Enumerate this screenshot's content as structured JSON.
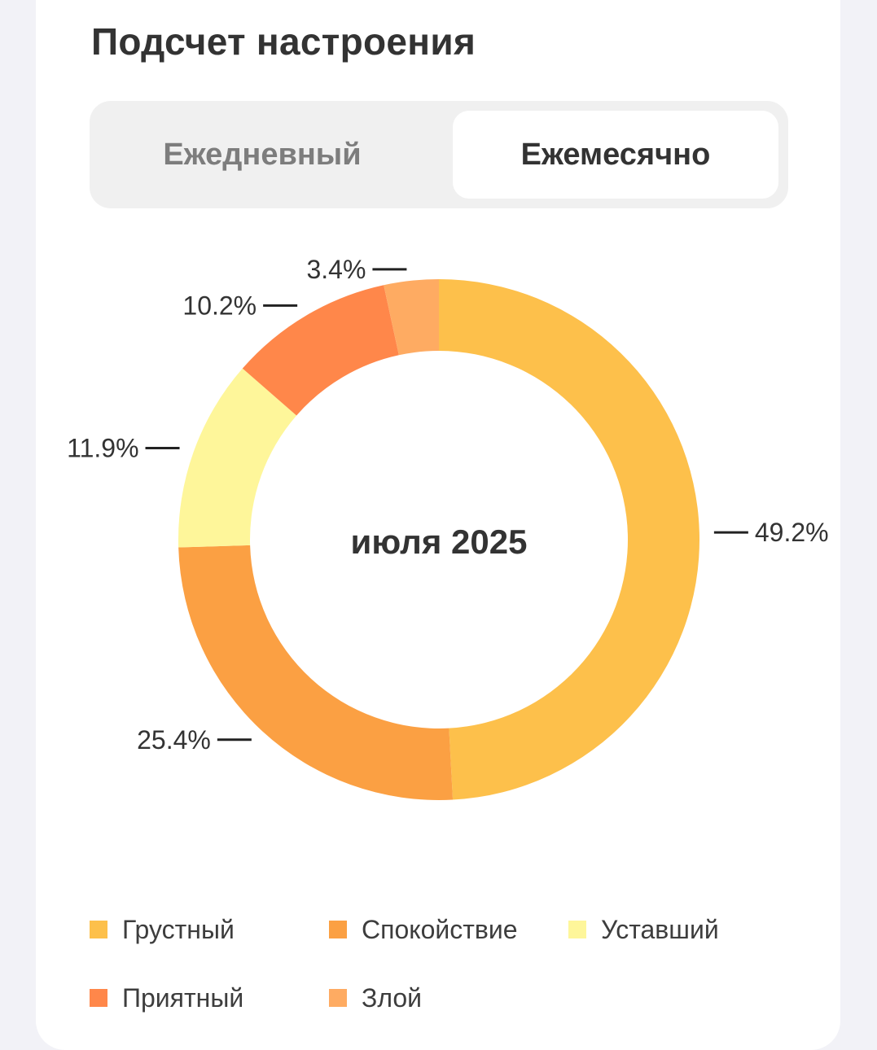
{
  "header": {
    "title": "Подсчет настроения"
  },
  "segmented": {
    "options": [
      "Ежедневный",
      "Ежемесячно"
    ],
    "selected": "Ежемесячно"
  },
  "chart_data": {
    "type": "pie",
    "donut": true,
    "center_label": "июля 2025",
    "slices": [
      {
        "name": "Грустный",
        "value": 49.2,
        "label": "49.2%",
        "color": "#FDC04B"
      },
      {
        "name": "Спокойствие",
        "value": 25.4,
        "label": "25.4%",
        "color": "#FBA043"
      },
      {
        "name": "Уставший",
        "value": 11.9,
        "label": "11.9%",
        "color": "#FEF69A"
      },
      {
        "name": "Приятный",
        "value": 10.2,
        "label": "10.2%",
        "color": "#FF874A"
      },
      {
        "name": "Злой",
        "value": 3.4,
        "label": "3.4%",
        "color": "#FEAB62"
      }
    ],
    "legend_position": "bottom"
  }
}
